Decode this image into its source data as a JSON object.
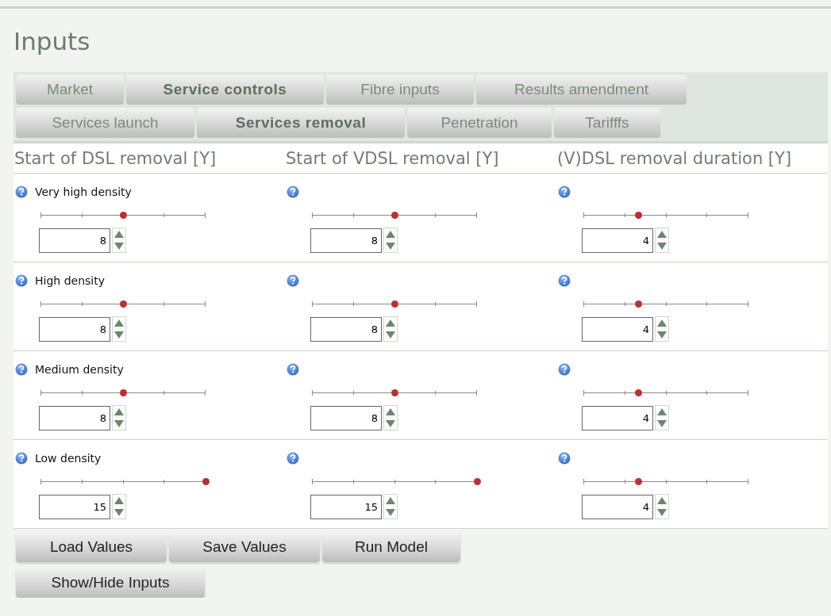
{
  "title": "Inputs",
  "tab_rows": [
    [
      {
        "label": "Market",
        "selected": false
      },
      {
        "label": "Service controls",
        "selected": true
      },
      {
        "label": "Fibre inputs",
        "selected": false
      },
      {
        "label": "Results amendment",
        "selected": false
      }
    ],
    [
      {
        "label": "Services launch",
        "selected": false
      },
      {
        "label": "Services removal",
        "selected": true
      },
      {
        "label": "Penetration",
        "selected": false
      },
      {
        "label": "Tarifffs",
        "selected": false
      }
    ]
  ],
  "columns": [
    "Start of DSL removal [Y]",
    "Start of VDSL removal [Y]",
    "(V)DSL removal duration [Y]"
  ],
  "rows": [
    {
      "label": "Very high density",
      "cells": [
        {
          "level": 0.5,
          "value": "8"
        },
        {
          "level": 0.5,
          "value": "8"
        },
        {
          "level": 0.33,
          "value": "4"
        }
      ]
    },
    {
      "label": "High density",
      "cells": [
        {
          "level": 0.5,
          "value": "8"
        },
        {
          "level": 0.5,
          "value": "8"
        },
        {
          "level": 0.33,
          "value": "4"
        }
      ]
    },
    {
      "label": "Medium density",
      "cells": [
        {
          "level": 0.5,
          "value": "8"
        },
        {
          "level": 0.5,
          "value": "8"
        },
        {
          "level": 0.33,
          "value": "4"
        }
      ]
    },
    {
      "label": "Low density",
      "cells": [
        {
          "level": 1.0,
          "value": "15"
        },
        {
          "level": 1.0,
          "value": "15"
        },
        {
          "level": 0.33,
          "value": "4"
        }
      ]
    }
  ],
  "buttons": [
    [
      "Load Values",
      "Save Values",
      "Run Model"
    ],
    [
      "Show/Hide Inputs"
    ]
  ]
}
